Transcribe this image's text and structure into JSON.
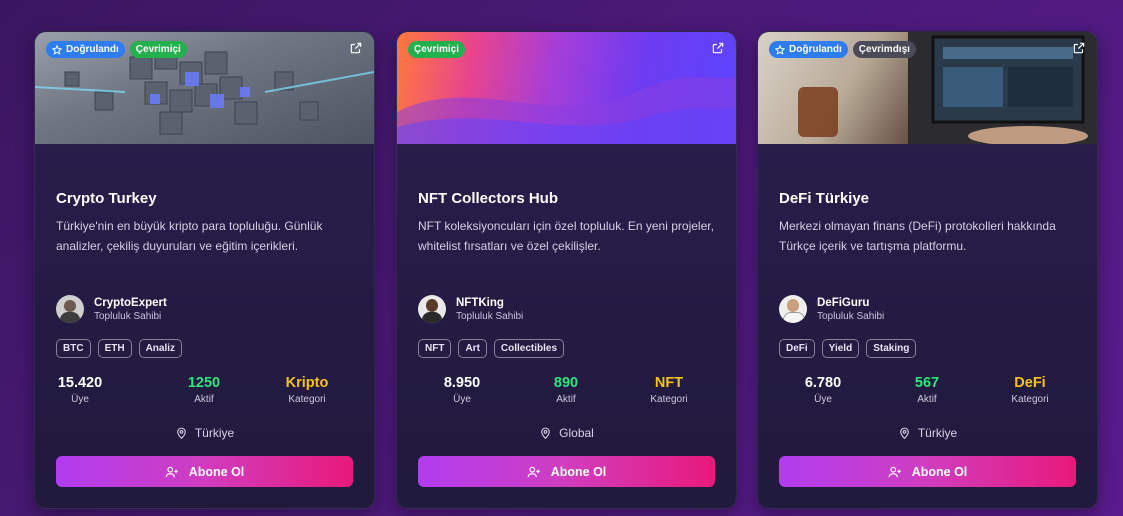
{
  "colors": {
    "accent_members": "#ffffff",
    "accent_active": "#2ee47b",
    "accent_category": "#f8c21a"
  },
  "cards": [
    {
      "badges": [
        "Doğrulandı",
        "Çevrimiçi"
      ],
      "title": "Crypto Turkey",
      "description": "Türkiye'nin en büyük kripto para topluluğu. Günlük analizler, çekiliş duyuruları ve eğitim içerikleri.",
      "owner": {
        "name": "CryptoExpert",
        "role": "Topluluk Sahibi"
      },
      "tags": [
        "BTC",
        "ETH",
        "Analiz"
      ],
      "stats": {
        "members": "15.420",
        "members_label": "Üye",
        "active": "1250",
        "active_label": "Aktif",
        "category": "Kripto",
        "category_label": "Kategori"
      },
      "location": "Türkiye",
      "button": "Abone Ol"
    },
    {
      "badges": [
        "Çevrimiçi"
      ],
      "title": "NFT Collectors Hub",
      "description": "NFT koleksiyoncuları için özel topluluk. En yeni projeler, whitelist fırsatları ve özel çekilişler.",
      "owner": {
        "name": "NFTKing",
        "role": "Topluluk Sahibi"
      },
      "tags": [
        "NFT",
        "Art",
        "Collectibles"
      ],
      "stats": {
        "members": "8.950",
        "members_label": "Üye",
        "active": "890",
        "active_label": "Aktif",
        "category": "NFT",
        "category_label": "Kategori"
      },
      "location": "Global",
      "button": "Abone Ol"
    },
    {
      "badges": [
        "Doğrulandı",
        "Çevrimdışı"
      ],
      "title": "DeFi Türkiye",
      "description": "Merkezi olmayan finans (DeFi) protokolleri hakkında Türkçe içerik ve tartışma platformu.",
      "owner": {
        "name": "DeFiGuru",
        "role": "Topluluk Sahibi"
      },
      "tags": [
        "DeFi",
        "Yield",
        "Staking"
      ],
      "stats": {
        "members": "6.780",
        "members_label": "Üye",
        "active": "567",
        "active_label": "Aktif",
        "category": "DeFi",
        "category_label": "Kategori"
      },
      "location": "Türkiye",
      "button": "Abone Ol"
    }
  ]
}
